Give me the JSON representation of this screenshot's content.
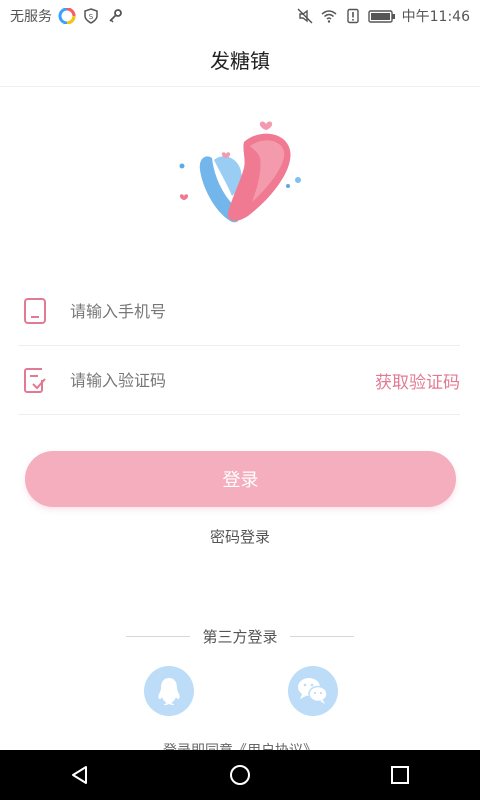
{
  "status_bar": {
    "carrier": "无服务",
    "time": "中午11:46",
    "icons": [
      "app-icon",
      "shield-icon",
      "key-icon",
      "mute-icon",
      "wifi-icon",
      "alert-icon",
      "battery-icon"
    ]
  },
  "header": {
    "title": "发糖镇"
  },
  "form": {
    "phone_placeholder": "请输入手机号",
    "code_placeholder": "请输入验证码",
    "get_code_label": "获取验证码"
  },
  "login_button": "登录",
  "password_login": "密码登录",
  "third_party": {
    "label": "第三方登录",
    "providers": [
      "qq-icon",
      "wechat-icon"
    ]
  },
  "agreement": "登录即同意《用户协议》",
  "colors": {
    "accent": "#e37a93",
    "button": "#f4aebd",
    "social": "#bcdcf8"
  }
}
